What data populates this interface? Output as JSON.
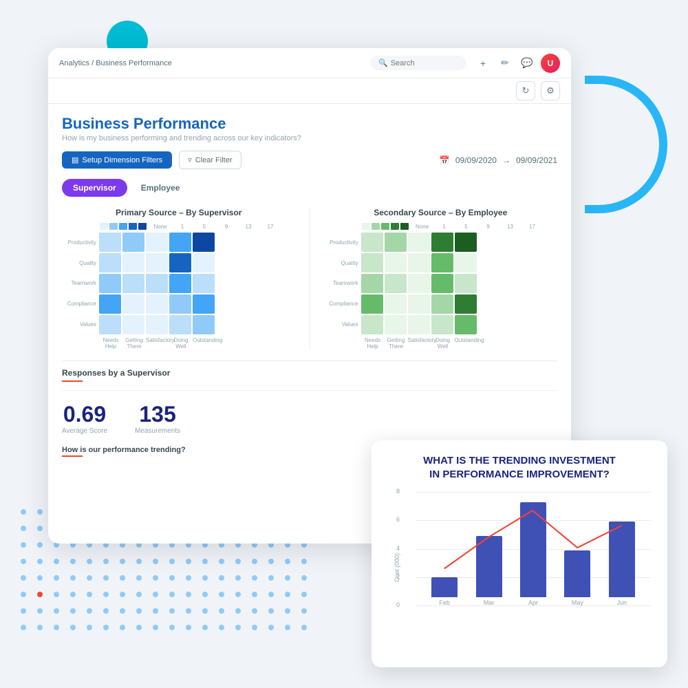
{
  "background": {
    "circle_color": "#00bcd4",
    "arc_color": "#29b6f6"
  },
  "breadcrumb": {
    "root": "Analytics",
    "separator": "/",
    "current": "Business Performance"
  },
  "search": {
    "placeholder": "Search"
  },
  "top_icons": [
    "+",
    "✏",
    "🔍"
  ],
  "settings_icons": [
    "↻",
    "⚙"
  ],
  "page": {
    "title": "Business Performance",
    "subtitle": "How is my business performing and trending across our key indicators?"
  },
  "filters": {
    "setup_btn": "Setup Dimension Filters",
    "clear_btn": "Clear Filter",
    "date_start": "09/09/2020",
    "date_arrow": "→",
    "date_end": "09/09/2021"
  },
  "tabs": [
    {
      "label": "Supervisor",
      "active": true
    },
    {
      "label": "Employee",
      "active": false
    }
  ],
  "primary_chart": {
    "title": "Primary Source – By Supervisor",
    "scale_labels": [
      "None",
      "1",
      "5",
      "9",
      "13",
      "17"
    ],
    "y_labels": [
      "Productivity",
      "Quality",
      "Teamwork",
      "Compliance",
      "Values"
    ],
    "x_labels": [
      "Needs Help",
      "Getting There",
      "Satisfactory",
      "Doing Well",
      "Outstanding"
    ],
    "cells_blue": [
      "b1",
      "b2",
      "b0",
      "b3",
      "b5",
      "b1",
      "b0",
      "b0",
      "b4",
      "b0",
      "b2",
      "b1",
      "b1",
      "b3",
      "b1",
      "b3",
      "b0",
      "b0",
      "b2",
      "b3",
      "b1",
      "b0",
      "b0",
      "b1",
      "b2"
    ]
  },
  "secondary_chart": {
    "title": "Secondary Source – By Employee",
    "scale_labels": [
      "None",
      "1",
      "5",
      "9",
      "13",
      "17"
    ],
    "y_labels": [
      "Productivity",
      "Quality",
      "Teamwork",
      "Compliance",
      "Values"
    ],
    "x_labels": [
      "Needs Help",
      "Getting There",
      "Satisfactory",
      "Doing Well",
      "Outstanding"
    ],
    "cells_green": [
      "g1",
      "g2",
      "g0",
      "g4",
      "g5",
      "g1",
      "g0",
      "g0",
      "g3",
      "g0",
      "g2",
      "g1",
      "g0",
      "g3",
      "g1",
      "g3",
      "g0",
      "g0",
      "g2",
      "g4",
      "g1",
      "g0",
      "g0",
      "g1",
      "g3"
    ]
  },
  "responses": {
    "section_title": "Responses by a Supervisor",
    "avg_score_value": "0.69",
    "avg_score_label": "Average Score",
    "measurements_value": "135",
    "measurements_label": "Measurements"
  },
  "trending_section": {
    "title": "How is our performance trending?"
  },
  "investment_card": {
    "title": "WHAT IS THE TRENDING INVESTMENT\nIN PERFORMANCE IMPROVEMENT?",
    "y_axis_label": "Cost (000)",
    "y_labels": [
      "8",
      "6",
      "4",
      "2",
      "0"
    ],
    "bars": [
      {
        "month": "Feb",
        "height_pct": 18,
        "value": 1.4
      },
      {
        "month": "Mar",
        "height_pct": 55,
        "value": 4.1
      },
      {
        "month": "Apr",
        "height_pct": 85,
        "value": 6.4
      },
      {
        "month": "May",
        "height_pct": 42,
        "value": 3.2
      },
      {
        "month": "Jun",
        "height_pct": 68,
        "value": 5.1
      }
    ],
    "line_points": "18,170 105,90 192,20 280,110 368,48",
    "line_color": "#f44336"
  }
}
